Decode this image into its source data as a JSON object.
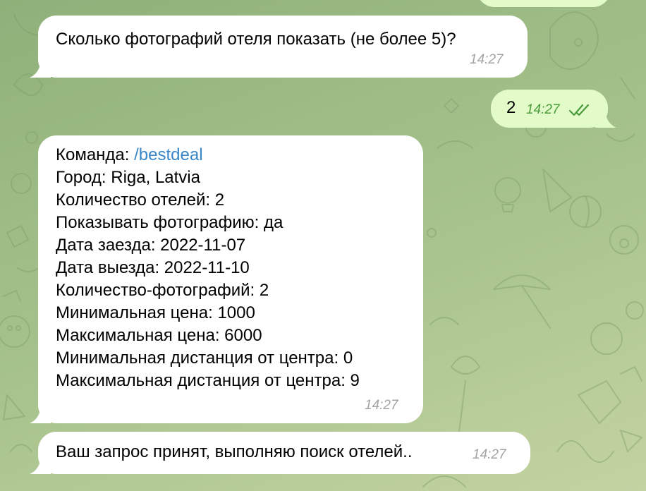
{
  "messages": [
    {
      "id": "m1",
      "direction": "in",
      "text": "Сколько фотографий отеля показать (не более 5)?",
      "time": "14:27"
    },
    {
      "id": "m2",
      "direction": "out",
      "text": "2",
      "time": "14:27",
      "status": "read"
    },
    {
      "id": "m3",
      "direction": "in",
      "time": "14:27",
      "lines": {
        "command_label": "Команда: ",
        "command_link": "/bestdeal",
        "city": "Город: Riga, Latvia",
        "hotels_count": "Количество отелей: 2",
        "show_photo": "Показывать фотографию: да",
        "checkin": "Дата заезда: 2022-11-07",
        "checkout": "Дата выезда: 2022-11-10",
        "photos_count": "Количество-фотографий: 2",
        "min_price": "Минимальная цена: 1000",
        "max_price": "Максимальная цена: 6000",
        "min_distance": "Минимальная дистанция от центра: 0",
        "max_distance": "Максимальная дистанция от центра: 9"
      }
    },
    {
      "id": "m4",
      "direction": "in",
      "text": "Ваш запрос принят, выполняю поиск отелей..",
      "time": "14:27"
    }
  ],
  "colors": {
    "incoming_bubble": "#ffffff",
    "outgoing_bubble": "#e3fbc9",
    "link": "#3a87c8",
    "time_in": "#a3a3a3",
    "time_out": "#4b9b3c"
  },
  "icons": {
    "read_status": "double-check-icon"
  }
}
